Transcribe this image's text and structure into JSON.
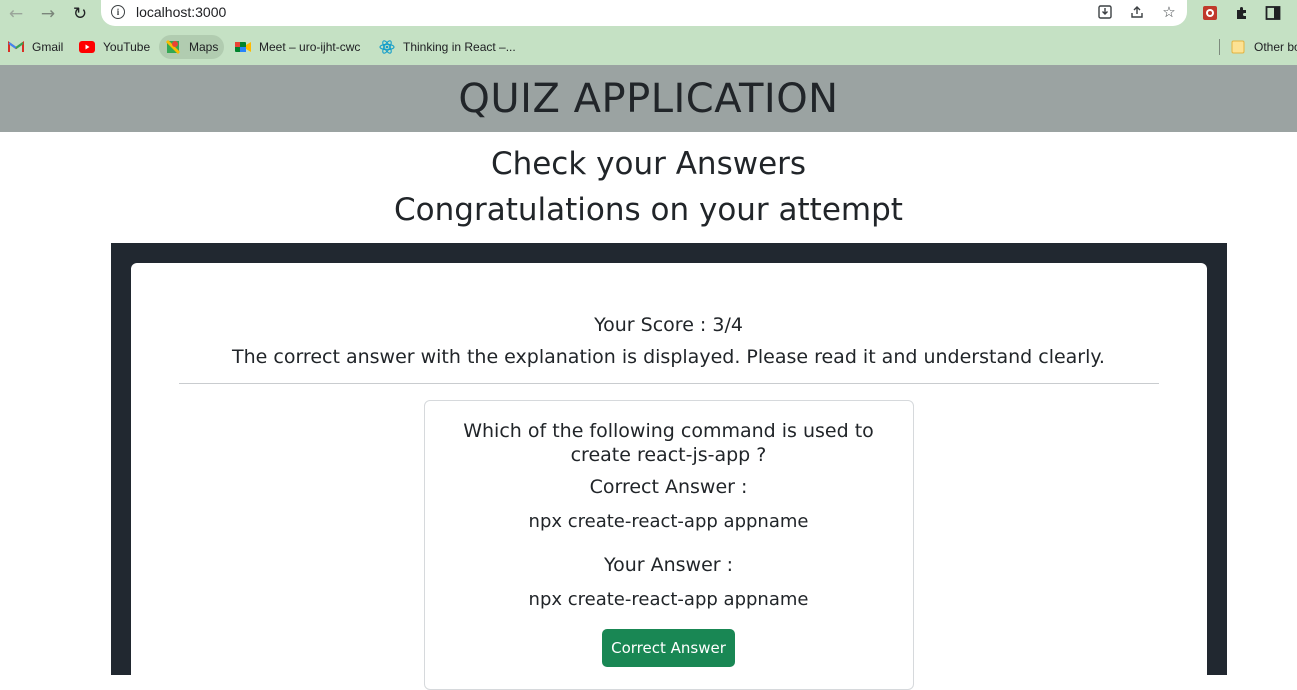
{
  "browser": {
    "url": "localhost:3000",
    "bookmarks": [
      {
        "label": "Gmail",
        "icon": "gmail-icon"
      },
      {
        "label": "YouTube",
        "icon": "youtube-icon"
      },
      {
        "label": "Maps",
        "icon": "maps-icon"
      },
      {
        "label": "Meet – uro-ijht-cwc",
        "icon": "meet-icon"
      },
      {
        "label": "Thinking in React –...",
        "icon": "react-icon"
      }
    ],
    "other_bookmarks": "Other bo"
  },
  "app": {
    "title": "QUIZ APPLICATION"
  },
  "results": {
    "heading": "Check your Answers",
    "subheading": "Congratulations on your attempt",
    "score": "Your Score : 3/4",
    "note": "The correct answer with the explanation is displayed. Please read it and understand clearly."
  },
  "question": {
    "text_line1": "Which of the following command is used to",
    "text_line2": "create react-js-app ?",
    "correct_label": "Correct Answer :",
    "correct_value": "npx create-react-app appname",
    "your_label": "Your Answer :",
    "your_value": "npx create-react-app appname",
    "status_button": "Correct Answer"
  },
  "colors": {
    "header_bg": "#9ba3a2",
    "panel_bg": "#212830",
    "success": "#198754",
    "chrome_bg": "#c5e1c4"
  }
}
